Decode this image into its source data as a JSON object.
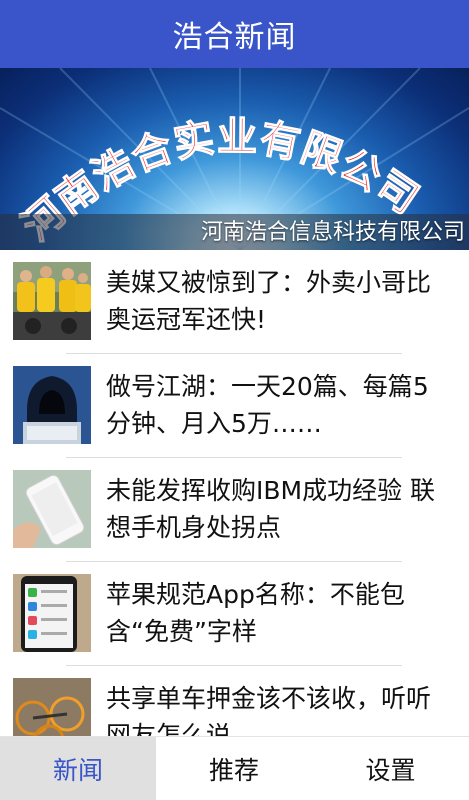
{
  "header": {
    "title": "浩合新闻",
    "bg_color": "#3a55c9"
  },
  "banner": {
    "logo_text": "河南浩合实业有限公司",
    "caption": "河南浩合信息科技有限公司",
    "logo_color": "#e8231d"
  },
  "news": [
    {
      "title": "美媒又被惊到了：外卖小哥比奥运冠军还快!",
      "thumb": "delivery-riders-photo"
    },
    {
      "title": "做号江湖：一天20篇、每篇5分钟、月入5万……",
      "thumb": "hooded-hacker-photo"
    },
    {
      "title": "未能发挥收购IBM成功经验 联想手机身处拐点",
      "thumb": "white-smartphone-photo"
    },
    {
      "title": "苹果规范App名称：不能包含“免费”字样",
      "thumb": "iphone-app-store-photo"
    },
    {
      "title": "共享单车押金该不该收，听听网友怎么说",
      "thumb": "shared-bikes-photo"
    }
  ],
  "tabs": [
    {
      "label": "新闻",
      "active": true
    },
    {
      "label": "推荐",
      "active": false
    },
    {
      "label": "设置",
      "active": false
    }
  ],
  "accent_color": "#3a55c9"
}
